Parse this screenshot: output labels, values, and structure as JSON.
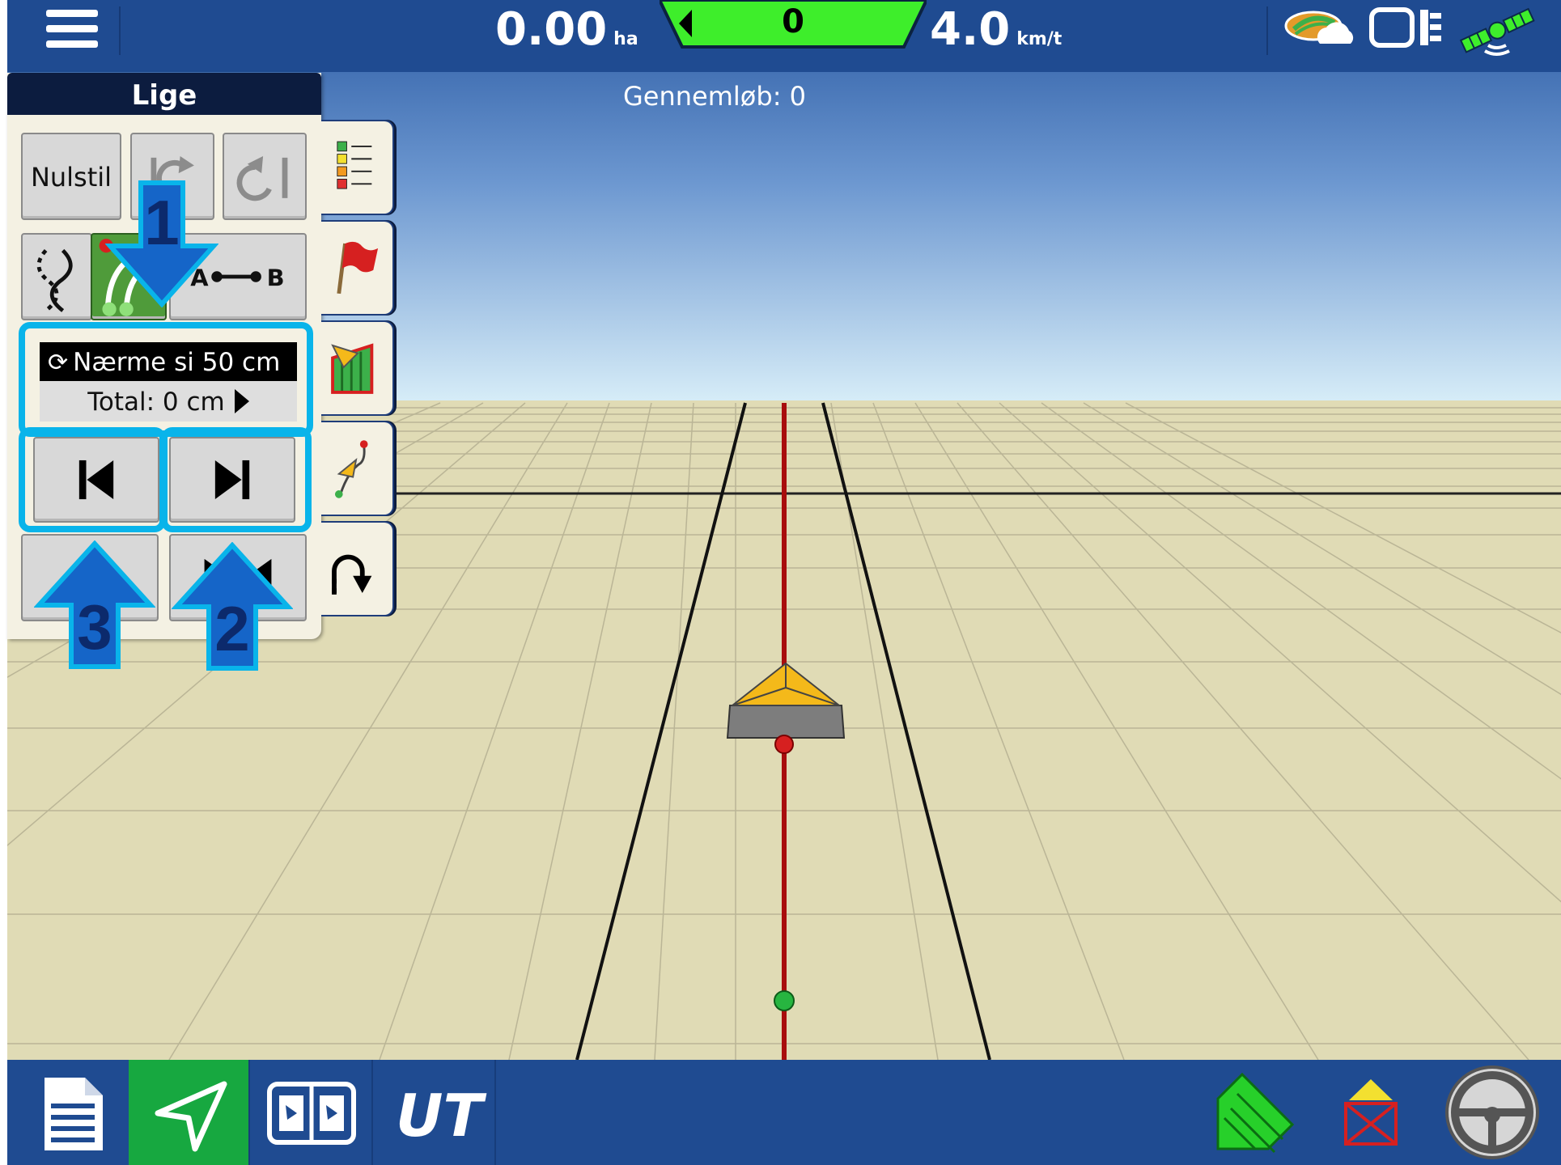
{
  "topbar": {
    "area_value": "0.00",
    "area_unit": "ha",
    "offline_value": "0",
    "speed_value": "4.0",
    "speed_unit": "km/t"
  },
  "pass_label": "Gennemløb: 0",
  "guidance_panel": {
    "title": "Lige",
    "reset_button": "Nulstil",
    "shift_mode": "Nærme si",
    "shift_amount": "50 cm",
    "total_shift": "Total: 0 cm"
  },
  "annotations": {
    "arrow_1": "1",
    "arrow_2": "2",
    "arrow_3": "3"
  },
  "icons": {
    "menu": "hamburger-icon",
    "weather": "weather-cloud-icon",
    "display": "display-split-icon",
    "gps": "satellite-icon",
    "task": "document-icon",
    "guidance": "navigation-arrow-icon",
    "maps": "map-split-icon",
    "ut": "universal-terminal-icon",
    "coverage": "field-coverage-icon",
    "implement": "implement-status-icon",
    "steering": "steering-wheel-icon"
  },
  "colors": {
    "bar_blue": "#1f4b91",
    "active_green": "#17a840",
    "highlight_cyan": "#09b4ea",
    "arrow_blue": "#1565c8",
    "guidance_line_red": "#a80d0d"
  }
}
